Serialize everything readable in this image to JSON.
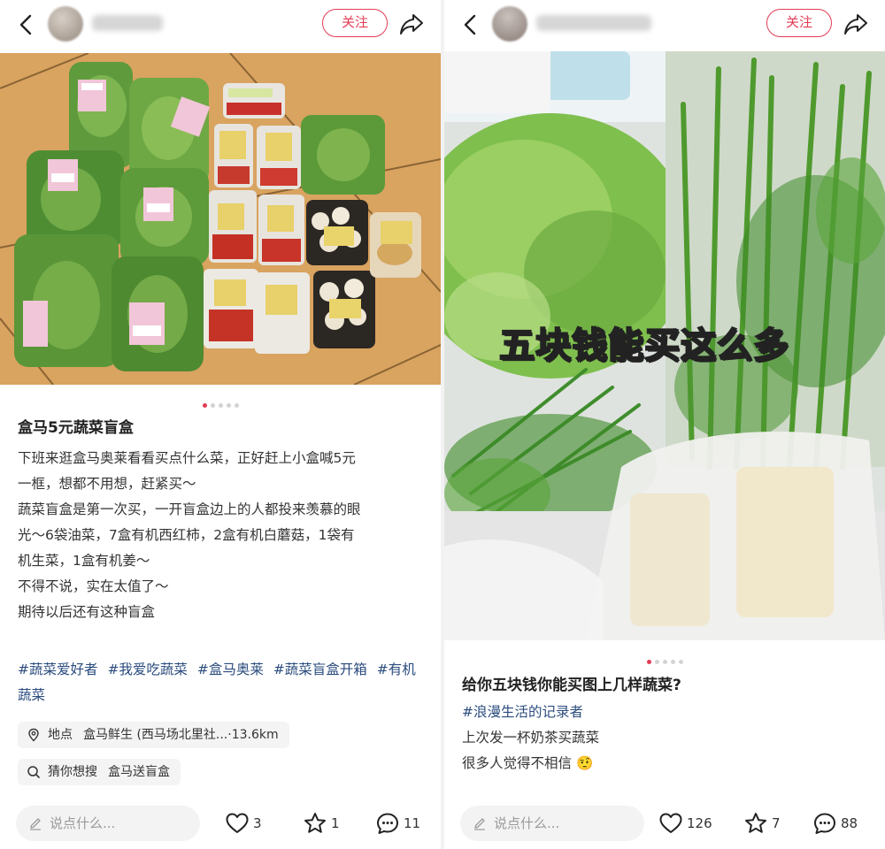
{
  "left_post": {
    "follow_label": "关注",
    "title": "盒马5元蔬菜盲盒",
    "body_lines": [
      "下班来逛盒马奥莱看看买点什么菜，正好赶上小盒喊5元",
      "一框，想都不用想，赶紧买～",
      "蔬菜盲盒是第一次买，一开盲盒边上的人都投来羡慕的眼",
      "光～6袋油菜，7盒有机西红柿，2盒有机白蘑菇，1袋有",
      "机生菜，1盒有机姜～",
      "不得不说，实在太值了～",
      "期待以后还有这种盲盒"
    ],
    "tags": [
      "#蔬菜爱好者",
      "#我爱吃蔬菜",
      "#盒马奥莱",
      "#蔬菜盲盒开箱",
      "#有机蔬菜"
    ],
    "location_label": "地点",
    "location_value": "盒马鲜生 (西马场北里社...",
    "location_distance": "·13.6km",
    "search_label": "猜你想搜",
    "search_value": "盒马送盲盒",
    "comment_placeholder": "说点什么...",
    "likes": "3",
    "stars": "1",
    "comments": "11",
    "slide_dots": 5,
    "active_dot": 0
  },
  "right_post": {
    "follow_label": "关注",
    "overlay_text": "五块钱能买这么多",
    "title": "给你五块钱你能买图上几样蔬菜?",
    "tag": "#浪漫生活的记录者",
    "body_lines": [
      "上次发一杯奶茶买蔬菜",
      "很多人觉得不相信"
    ],
    "emoji": "🤨",
    "comment_placeholder": "说点什么...",
    "likes": "126",
    "stars": "7",
    "comments": "88",
    "slide_dots": 5,
    "active_dot": 0
  },
  "colors": {
    "accent": "#e23b55",
    "tag_blue": "#2b4c7e"
  }
}
